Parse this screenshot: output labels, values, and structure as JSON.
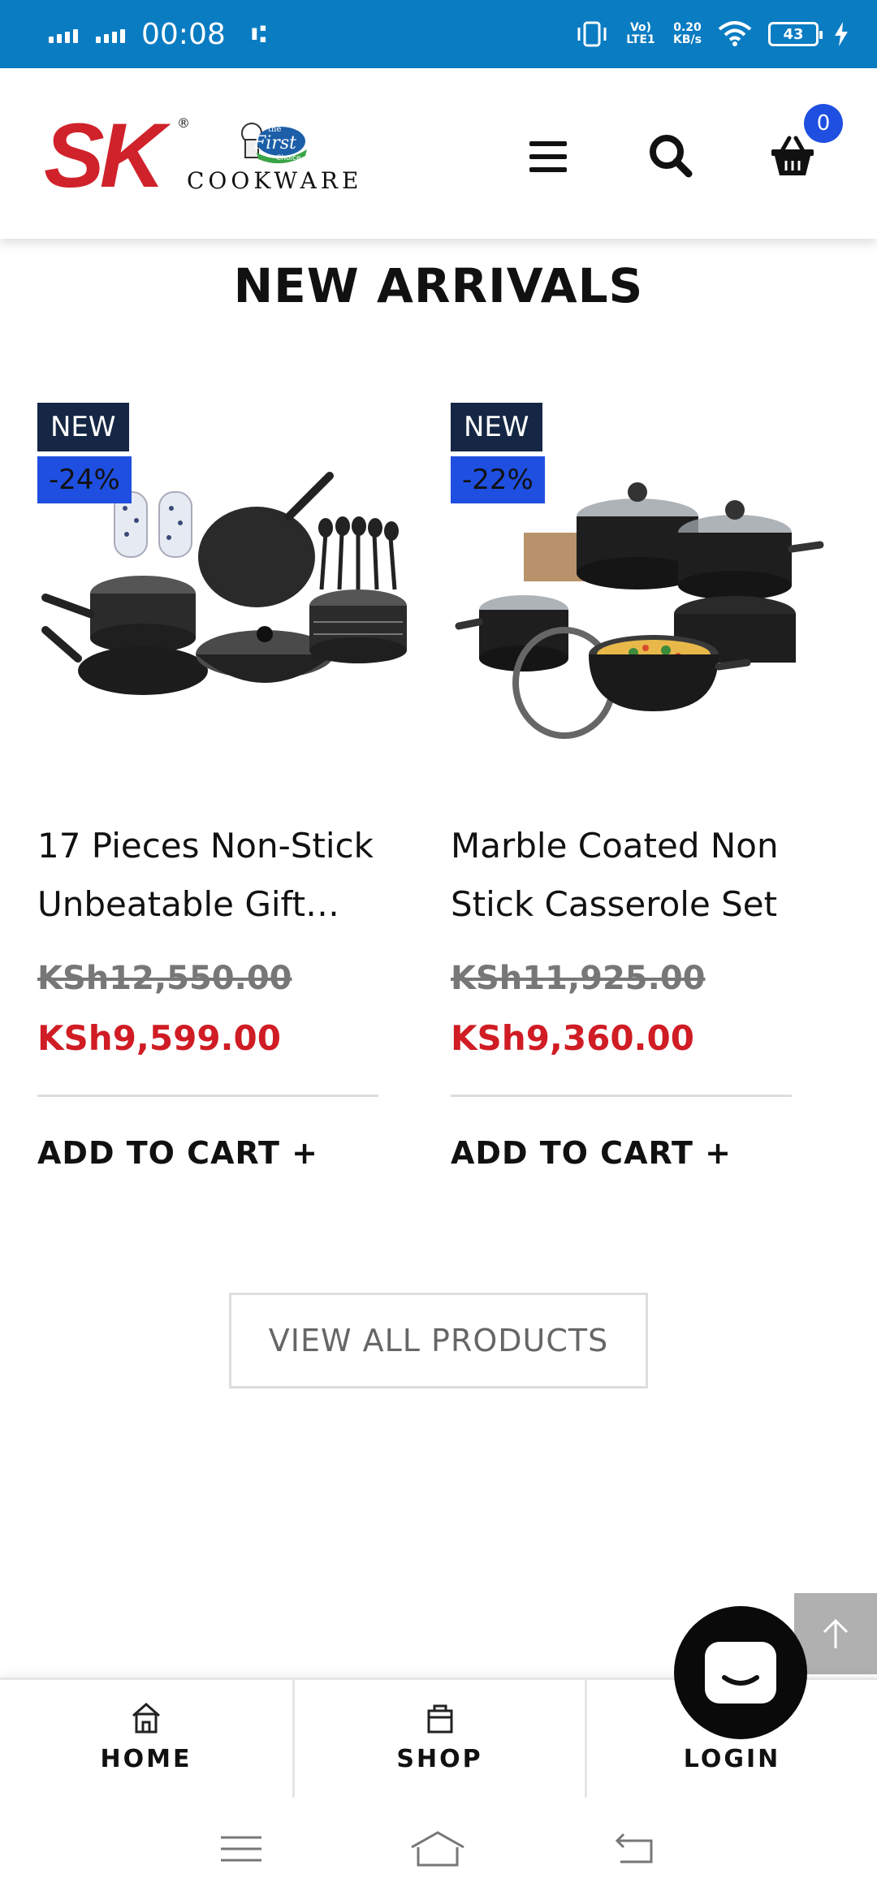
{
  "status_bar": {
    "time": "00:08",
    "network_label": "Vo) LTE1",
    "speed_value": "0.20",
    "speed_unit": "KB/s",
    "battery_level": "43"
  },
  "header": {
    "logo_text": "SK",
    "logo_reg": "®",
    "logo_sub_top": "the",
    "logo_sub_main": "First",
    "logo_sub_bottom": "Choice",
    "logo_cookware": "COOKWARE",
    "cart_count": "0"
  },
  "section": {
    "title": "NEW ARRIVALS"
  },
  "products": [
    {
      "badge_new": "NEW",
      "badge_discount": "-24%",
      "name": "17 Pieces Non-Stick Unbeatable Gift…",
      "price_old": "KSh12,550.00",
      "price_new": "KSh9,599.00",
      "add_to_cart": "ADD TO CART +"
    },
    {
      "badge_new": "NEW",
      "badge_discount": "-22%",
      "name": "Marble Coated Non Stick Casserole Set",
      "price_old": "KSh11,925.00",
      "price_new": "KSh9,360.00",
      "add_to_cart": "ADD TO CART +"
    }
  ],
  "view_all": "VIEW ALL PRODUCTS",
  "bottom_nav": {
    "home": "HOME",
    "shop": "SHOP",
    "login": "LOGIN"
  },
  "colors": {
    "status_bar": "#0a7cc2",
    "brand_red": "#d0222b",
    "badge_navy": "#152744",
    "accent_blue": "#1f4fe0",
    "sale_red": "#d01c24"
  },
  "icons": [
    "menu-icon",
    "search-icon",
    "basket-icon",
    "arrow-up-icon",
    "chat-icon",
    "home-icon",
    "shop-bag-icon",
    "user-icon"
  ]
}
